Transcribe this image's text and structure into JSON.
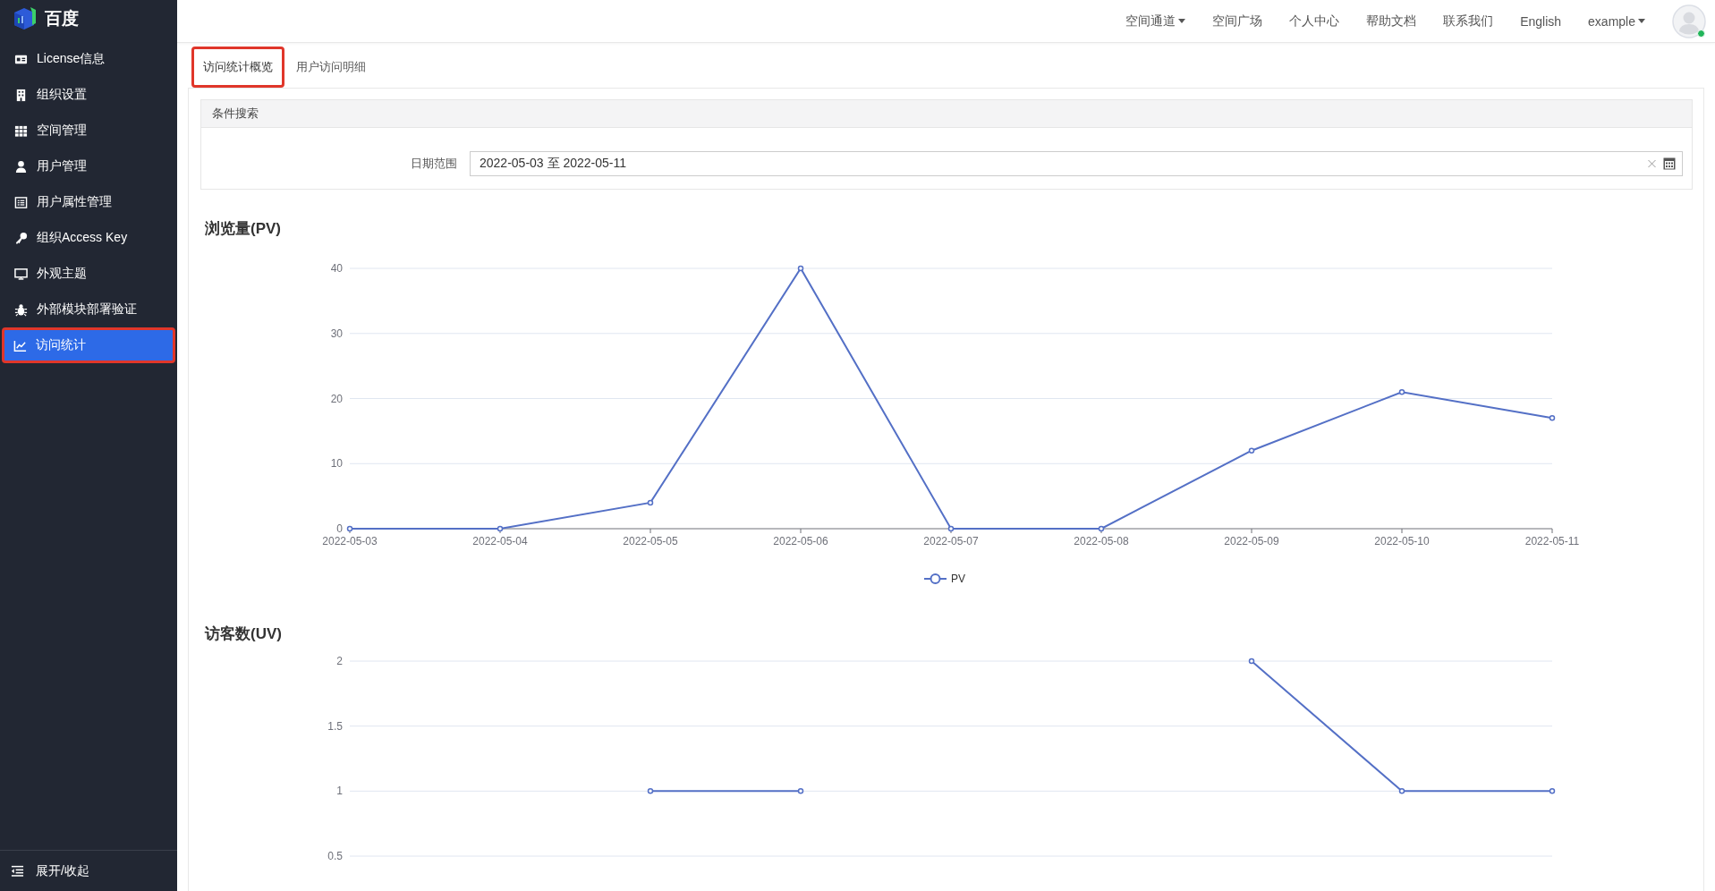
{
  "brand": {
    "name": "百度"
  },
  "sidebar": {
    "items": [
      {
        "label": "License信息",
        "selected": false
      },
      {
        "label": "组织设置",
        "selected": false
      },
      {
        "label": "空间管理",
        "selected": false
      },
      {
        "label": "用户管理",
        "selected": false
      },
      {
        "label": "用户属性管理",
        "selected": false
      },
      {
        "label": "组织Access Key",
        "selected": false
      },
      {
        "label": "外观主题",
        "selected": false
      },
      {
        "label": "外部模块部署验证",
        "selected": false
      },
      {
        "label": "访问统计",
        "selected": true
      }
    ],
    "collapse_label": "展开/收起"
  },
  "topnav": {
    "items": [
      {
        "label": "空间通道",
        "dropdown": true
      },
      {
        "label": "空间广场",
        "dropdown": false
      },
      {
        "label": "个人中心",
        "dropdown": false
      },
      {
        "label": "帮助文档",
        "dropdown": false
      },
      {
        "label": "联系我们",
        "dropdown": false
      },
      {
        "label": "English",
        "dropdown": false
      },
      {
        "label": "example",
        "dropdown": true
      }
    ],
    "user": {
      "online": true
    }
  },
  "tabs": [
    {
      "label": "访问统计概览",
      "selected": true
    },
    {
      "label": "用户访问明细",
      "selected": false
    }
  ],
  "search": {
    "title": "条件搜索",
    "date_label": "日期范围",
    "date_value": "2022-05-03 至 2022-05-11"
  },
  "charts": [
    {
      "title": "浏览量(PV)",
      "chart_data": {
        "type": "line",
        "categories": [
          "2022-05-03",
          "2022-05-04",
          "2022-05-05",
          "2022-05-06",
          "2022-05-07",
          "2022-05-08",
          "2022-05-09",
          "2022-05-10",
          "2022-05-11"
        ],
        "series": [
          {
            "name": "PV",
            "color": "#5470c6",
            "marker": true,
            "values": [
              0,
              0,
              4,
              40,
              0,
              0,
              12,
              21,
              17
            ]
          }
        ],
        "ylim": [
          0,
          40
        ],
        "yticks": [
          0,
          10,
          20,
          30,
          40
        ],
        "grid": true
      }
    },
    {
      "title": "访客数(UV)",
      "chart_data": {
        "type": "line",
        "series": [
          {
            "color": "#5470c6",
            "marker": true,
            "values": [
              null,
              null,
              1,
              1,
              null,
              null,
              2,
              1,
              1
            ]
          }
        ],
        "ylim": [
          0.5,
          2
        ],
        "yticks": [
          0.5,
          1,
          1.5,
          2
        ],
        "grid": true
      }
    }
  ]
}
